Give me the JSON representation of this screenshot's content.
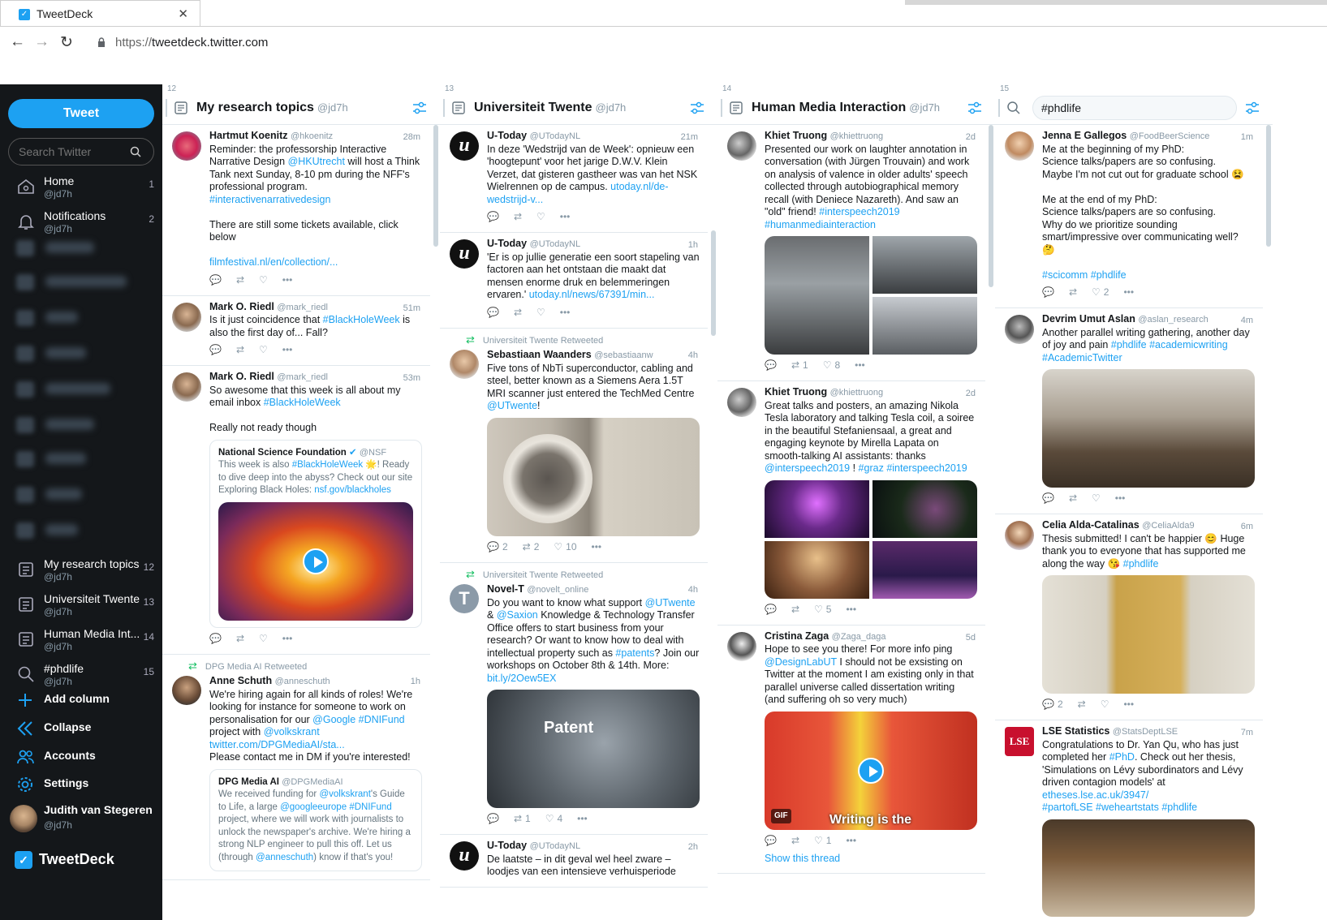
{
  "browser": {
    "tab_title": "TweetDeck",
    "url_scheme": "https://",
    "url_host": "tweetdeck.twitter.com"
  },
  "sidebar": {
    "tweet_label": "Tweet",
    "search_placeholder": "Search Twitter",
    "nav": [
      {
        "label": "Home",
        "sub": "@jd7h",
        "count": "1"
      },
      {
        "label": "Notifications",
        "sub": "@jd7h",
        "count": "2"
      }
    ],
    "columns": [
      {
        "label": "My research topics",
        "sub": "@jd7h",
        "count": "12"
      },
      {
        "label": "Universiteit Twente",
        "sub": "@jd7h",
        "count": "13"
      },
      {
        "label": "Human Media Int...",
        "sub": "@jd7h",
        "count": "14"
      },
      {
        "label": "#phdlife",
        "sub": "@jd7h",
        "count": "15"
      }
    ],
    "actions": {
      "add": "Add column",
      "collapse": "Collapse",
      "accounts": "Accounts",
      "settings": "Settings"
    },
    "user": {
      "name": "Judith van Stegeren",
      "handle": "@jd7h"
    },
    "brand": "TweetDeck"
  },
  "columns": [
    {
      "num": "12",
      "title": "My research topics",
      "handle": "@jd7h",
      "tweets": [
        {
          "name": "Hartmut Koenitz",
          "handle": "@hkoenitz",
          "time": "28m",
          "text1": "Reminder: the professorship Interactive Narrative Design ",
          "l1": "@HKUtrecht",
          "text2": " will host a Think Tank next Sunday, 8-10 pm during the NFF's professional program.",
          "l2": "#interactivenarrativedesign",
          "text3": "There are still some tickets available, click below",
          "l3": "filmfestival.nl/en/collection/..."
        },
        {
          "name": "Mark O. Riedl",
          "handle": "@mark_riedl",
          "time": "51m",
          "text1": "Is it just coincidence that ",
          "l1": "#BlackHoleWeek",
          "text2": " is also the first day of... Fall?"
        },
        {
          "name": "Mark O. Riedl",
          "handle": "@mark_riedl",
          "time": "53m",
          "text1": "So awesome that this week is all about my email inbox ",
          "l1": "#BlackHoleWeek",
          "text2": "Really not ready though",
          "quote": {
            "name": "National Science Foundation",
            "handle": "@NSF",
            "t1": "This week is also ",
            "l1": "#BlackHoleWeek",
            "t2": " 🌟! Ready to dive deep into the abyss? Check out our site Exploring Black Holes: ",
            "l2": "nsf.gov/blackholes"
          }
        },
        {
          "rt": "DPG Media AI Retweeted",
          "name": "Anne Schuth",
          "handle": "@anneschuth",
          "time": "1h",
          "text1": "We're hiring again for all kinds of roles! We're looking for instance for someone to work on personalisation for our ",
          "l1": "@Google",
          "l2": "#DNIFund",
          "text2": " project with ",
          "l3": "@volkskrant",
          "l4": "twitter.com/DPGMediaAI/sta...",
          "text3": "Please contact me in DM if you're interested!",
          "quote": {
            "name": "DPG Media AI",
            "handle": "@DPGMediaAI",
            "t1": "We received funding for ",
            "l1": "@volkskrant",
            "t2": "'s Guide to Life, a large ",
            "l2": "@googleeurope",
            "l3": "#DNIFund",
            "t3": " project, where we will work with journalists to unlock the newspaper's archive. We're hiring a strong NLP engineer to pull this off. Let us (through ",
            "l4": "@anneschuth",
            "t4": ") know if that's you!"
          }
        }
      ]
    },
    {
      "num": "13",
      "title": "Universiteit Twente",
      "handle": "@jd7h",
      "tweets": [
        {
          "name": "U-Today",
          "handle": "@UTodayNL",
          "time": "21m",
          "text1": "In deze 'Wedstrijd van de Week': opnieuw een 'hoogtepunt' voor het jarige D.W.V. Klein Verzet, dat gisteren gastheer was van het NSK Wielrennen op de campus. ",
          "l1": "utoday.nl/de-wedstrijd-v..."
        },
        {
          "name": "U-Today",
          "handle": "@UTodayNL",
          "time": "1h",
          "text1": "'Er is op jullie generatie een soort stapeling van factoren aan het ontstaan die maakt dat mensen enorme druk en belemmeringen ervaren.' ",
          "l1": "utoday.nl/news/67391/min..."
        },
        {
          "rt": "Universiteit Twente Retweeted",
          "name": "Sebastiaan Waanders",
          "handle": "@sebastiaanw",
          "time": "4h",
          "text1": "Five tons of NbTi superconductor, cabling and steel, better known as a Siemens Aera 1.5T MRI scanner just entered the TechMed Centre ",
          "l1": "@UTwente",
          "text2": "!",
          "replies": "2",
          "rts": "2",
          "likes": "10"
        },
        {
          "rt": "Universiteit Twente Retweeted",
          "name": "Novel-T",
          "handle": "@novelt_online",
          "time": "4h",
          "text1": "Do you want to know what support ",
          "l1": "@UTwente",
          "text2": " & ",
          "l2": "@Saxion",
          "text3": " Knowledge & Technology Transfer Office offers to start business from your research? Or want to know how to deal with intellectual property such as ",
          "l3": "#patents",
          "text4": "? Join our workshops on October 8th & 14th. More: ",
          "l4": "bit.ly/2Oew5EX",
          "media_label": "Patent",
          "rts": "1",
          "likes": "4"
        },
        {
          "name": "U-Today",
          "handle": "@UTodayNL",
          "time": "2h",
          "text1": "De laatste – in dit geval wel heel zware – loodjes van een intensieve verhuisperiode"
        }
      ]
    },
    {
      "num": "14",
      "title": "Human Media Interaction",
      "handle": "@jd7h",
      "tweets": [
        {
          "name": "Khiet Truong",
          "handle": "@khiettruong",
          "time": "2d",
          "text1": "Presented our work on laughter annotation in conversation (with Jürgen Trouvain) and work on analysis of valence in older adults' speech collected through autobiographical memory recall (with Deniece Nazareth). And saw an \"old\" friend! ",
          "l1": "#interspeech2019",
          "l2": "#humanmediainteraction",
          "rts": "1",
          "likes": "8"
        },
        {
          "name": "Khiet Truong",
          "handle": "@khiettruong",
          "time": "2d",
          "text1": "Great talks and posters, an amazing Nikola Tesla laboratory and talking Tesla coil, a soiree in the beautiful Stefaniensaal, a great and engaging keynote by Mirella Lapata on smooth-talking AI assistants: thanks ",
          "l1": "@interspeech2019",
          "text2": " ! ",
          "l2": "#graz",
          "l3": "#interspeech2019",
          "likes": "5"
        },
        {
          "name": "Cristina Zaga",
          "handle": "@Zaga_daga",
          "time": "5d",
          "text1": "Hope to see you there! For more info ping ",
          "l1": "@DesignLabUT",
          "text2": " I should not be exsisting on Twitter at the moment I am existing only in that parallel universe called dissertation writing (and suffering oh so very much)",
          "gif": "GIF",
          "caption": "Writing is the",
          "likes": "1",
          "thread": "Show this thread"
        }
      ]
    },
    {
      "num": "15",
      "search": "#phdlife",
      "tweets": [
        {
          "name": "Jenna E Gallegos",
          "handle": "@FoodBeerScience",
          "time": "1m",
          "text1": "Me at the beginning of my PhD:\nScience talks/papers are so confusing.\nMaybe I'm not cut out for graduate school 😫\n\nMe at the end of my PhD:\nScience talks/papers are so confusing.\nWhy do we prioritize sounding smart/impressive over communicating well?\n🤔",
          "l1": "#scicomm",
          "l2": "#phdlife",
          "likes": "2"
        },
        {
          "name": "Devrim Umut Aslan",
          "handle": "@aslan_research",
          "time": "4m",
          "text1": "Another parallel writing gathering, another day of joy and pain ",
          "l1": "#phdlife",
          "l2": "#academicwriting",
          "l3": "#AcademicTwitter"
        },
        {
          "name": "Celia Alda-Catalinas",
          "handle": "@CeliaAlda9",
          "time": "6m",
          "text1": "Thesis submitted! I can't be happier 😊 Huge thank you to everyone that has supported me along the way 😘 ",
          "l1": "#phdlife",
          "replies": "2"
        },
        {
          "name": "LSE Statistics",
          "handle": "@StatsDeptLSE",
          "time": "7m",
          "text1": "Congratulations to Dr. Yan Qu, who has just completed her ",
          "l1": "#PhD",
          "text2": ". Check out her thesis, 'Simulations on Lévy subordinators and Lévy driven contagion models' at ",
          "l2": "etheses.lse.ac.uk/3947/",
          "l3": "#partofLSE",
          "l4": "#weheartstats",
          "l5": "#phdlife"
        }
      ]
    }
  ],
  "colors": {
    "accent": "#1da1f2",
    "sidebar": "#14171a",
    "muted": "#8899a6",
    "retweet": "#17bf63"
  }
}
